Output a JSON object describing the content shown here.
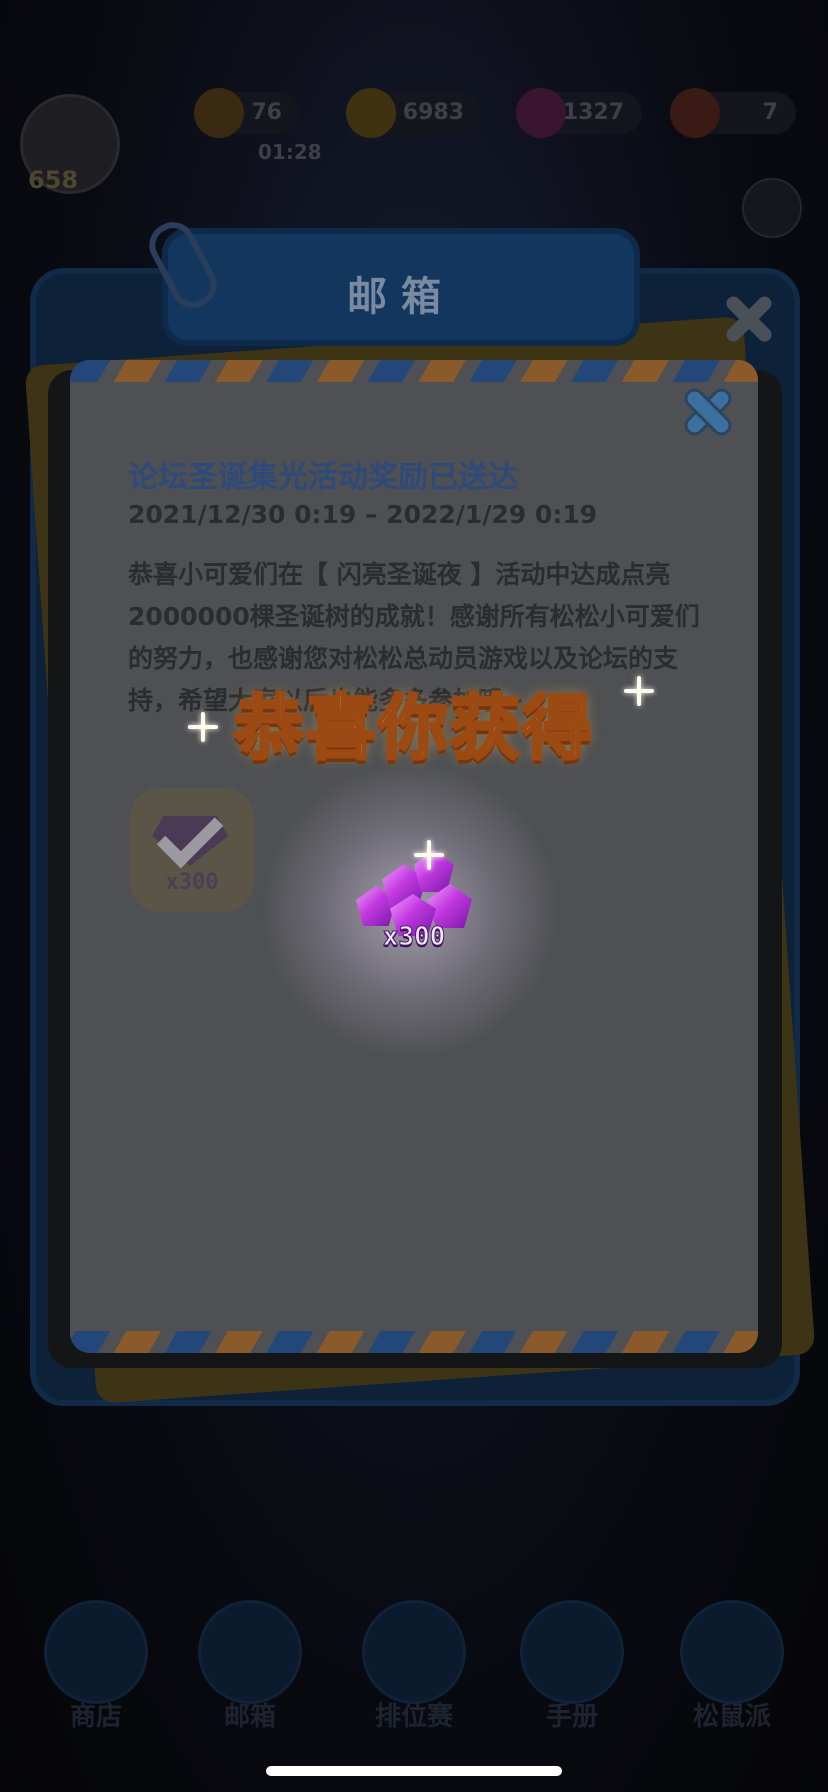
{
  "background": {
    "top_bar": {
      "level": "658",
      "resources": [
        "76",
        "6983",
        "1327",
        "7"
      ],
      "sub_value": "01:28"
    },
    "mailbox_title": "邮箱",
    "nav_items": [
      "商店",
      "邮箱",
      "排位赛",
      "手册",
      "松鼠派"
    ]
  },
  "mail": {
    "title": "论坛圣诞集光活动奖励已送达",
    "date_range": "2021/12/30  0:19 – 2022/1/29  0:19",
    "body": "恭喜小可爱们在【 闪亮圣诞夜 】活动中达成点亮2000000棵圣诞树的成就！感谢所有松松小可爱们的努力，也感谢您对松松总动员游戏以及论坛的支持，希望大家以后也能多多参加哦~",
    "reward": {
      "icon": "gem-icon",
      "quantity": "x300",
      "claimed": true
    }
  },
  "popup": {
    "title": "恭喜你获得",
    "item_icon": "purple-gem-icon",
    "item_quantity": "x300"
  },
  "colors": {
    "title_gold": "#ffcf4a",
    "gem_purple": "#c23ae0",
    "mail_title_blue": "#2d4a7a"
  }
}
